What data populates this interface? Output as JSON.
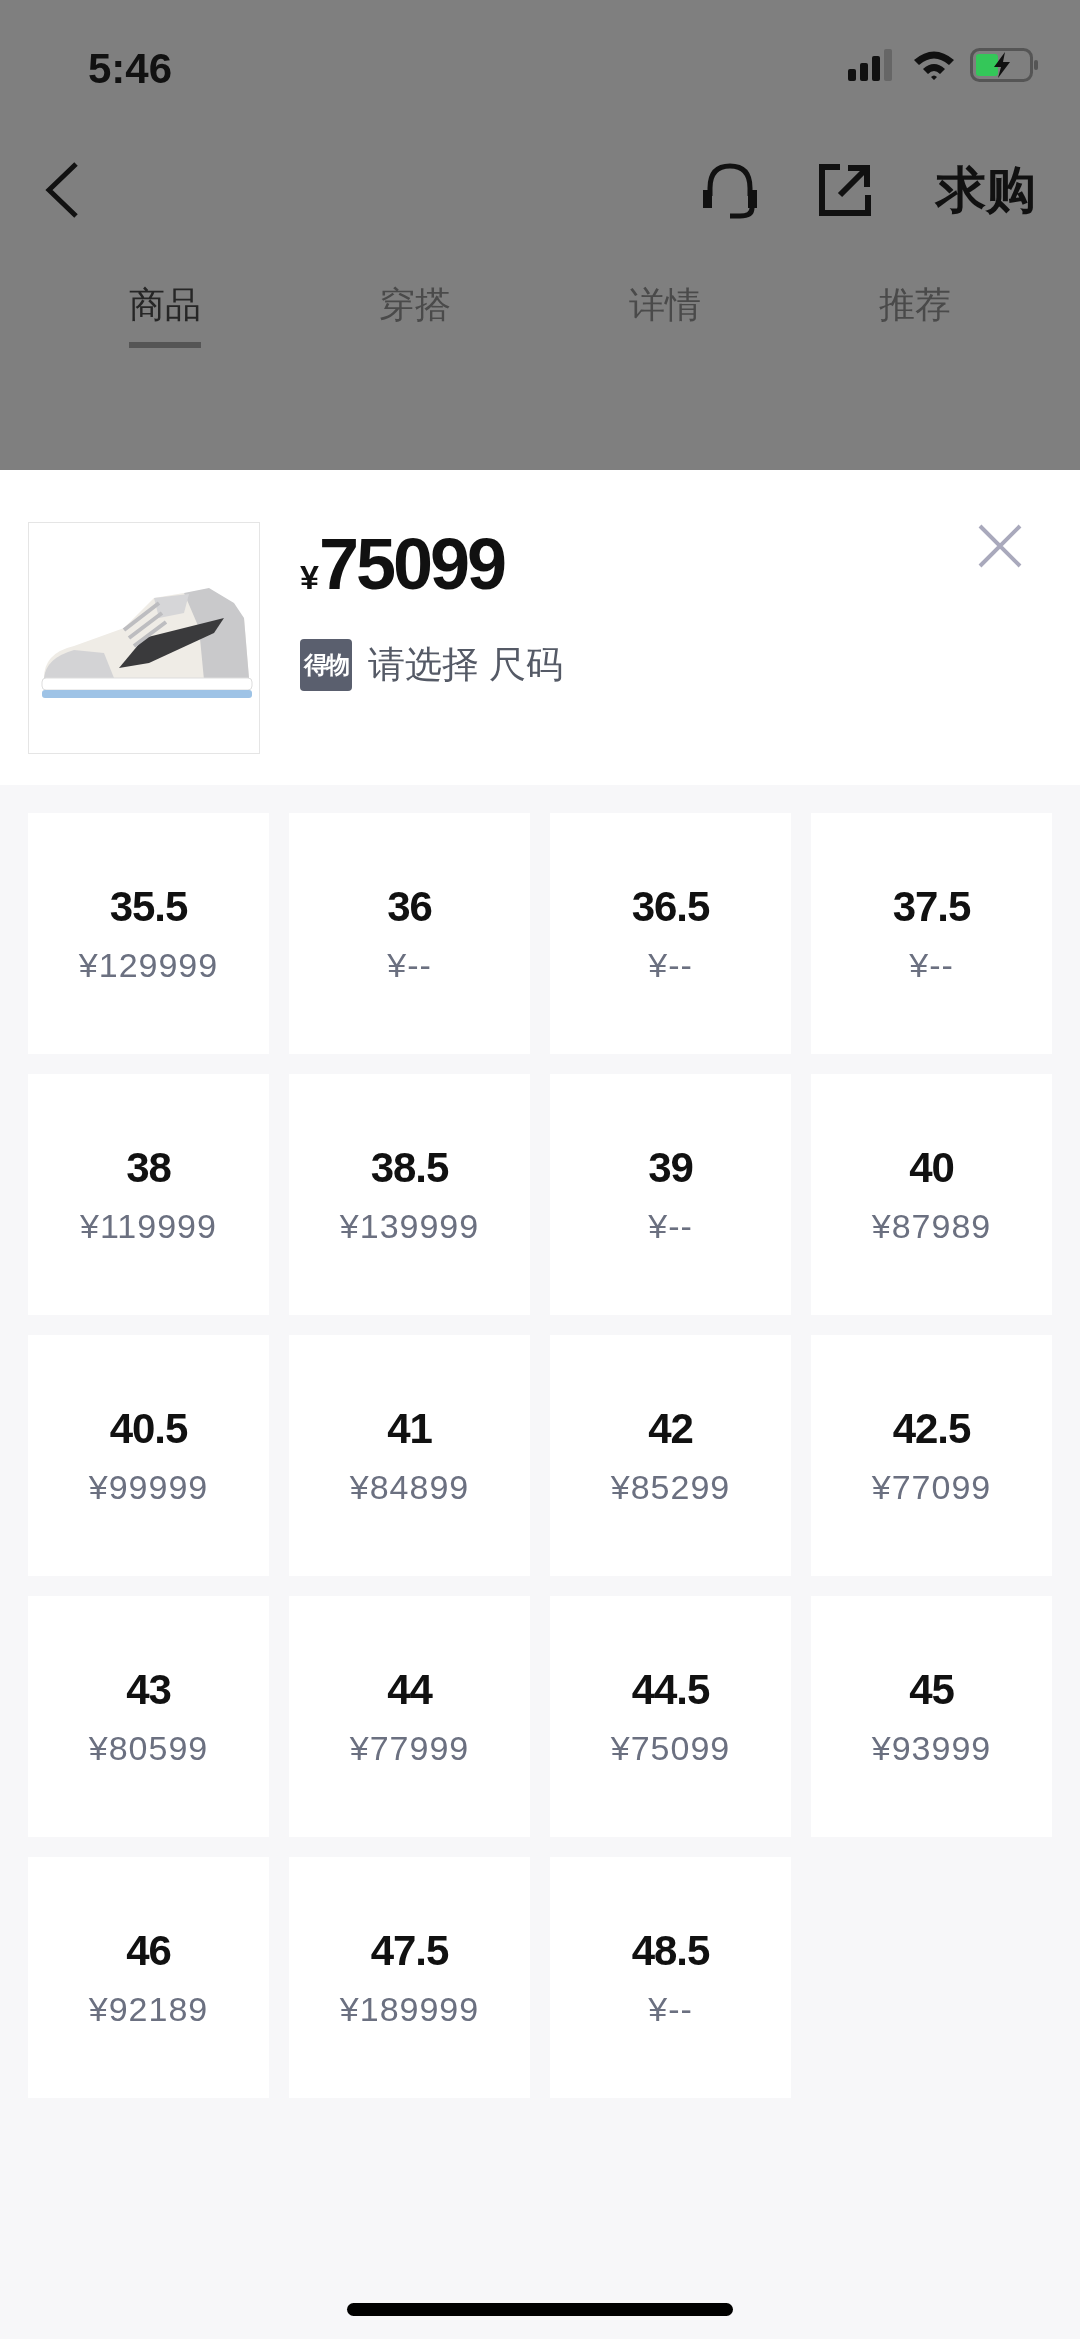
{
  "status_bar": {
    "time": "5:46"
  },
  "nav": {
    "action": "求购"
  },
  "tabs": [
    {
      "label": "商品",
      "selected": true
    },
    {
      "label": "穿搭",
      "selected": false
    },
    {
      "label": "详情",
      "selected": false
    },
    {
      "label": "推荐",
      "selected": false
    }
  ],
  "sheet": {
    "currency": "¥",
    "price": "75099",
    "badge": "得物",
    "prompt": "请选择 尺码"
  },
  "sizes": [
    {
      "size": "35.5",
      "price": "¥129999"
    },
    {
      "size": "36",
      "price": "¥--"
    },
    {
      "size": "36.5",
      "price": "¥--"
    },
    {
      "size": "37.5",
      "price": "¥--"
    },
    {
      "size": "38",
      "price": "¥119999"
    },
    {
      "size": "38.5",
      "price": "¥139999"
    },
    {
      "size": "39",
      "price": "¥--"
    },
    {
      "size": "40",
      "price": "¥87989"
    },
    {
      "size": "40.5",
      "price": "¥99999"
    },
    {
      "size": "41",
      "price": "¥84899"
    },
    {
      "size": "42",
      "price": "¥85299"
    },
    {
      "size": "42.5",
      "price": "¥77099"
    },
    {
      "size": "43",
      "price": "¥80599"
    },
    {
      "size": "44",
      "price": "¥77999"
    },
    {
      "size": "44.5",
      "price": "¥75099"
    },
    {
      "size": "45",
      "price": "¥93999"
    },
    {
      "size": "46",
      "price": "¥92189"
    },
    {
      "size": "47.5",
      "price": "¥189999"
    },
    {
      "size": "48.5",
      "price": "¥--"
    }
  ]
}
